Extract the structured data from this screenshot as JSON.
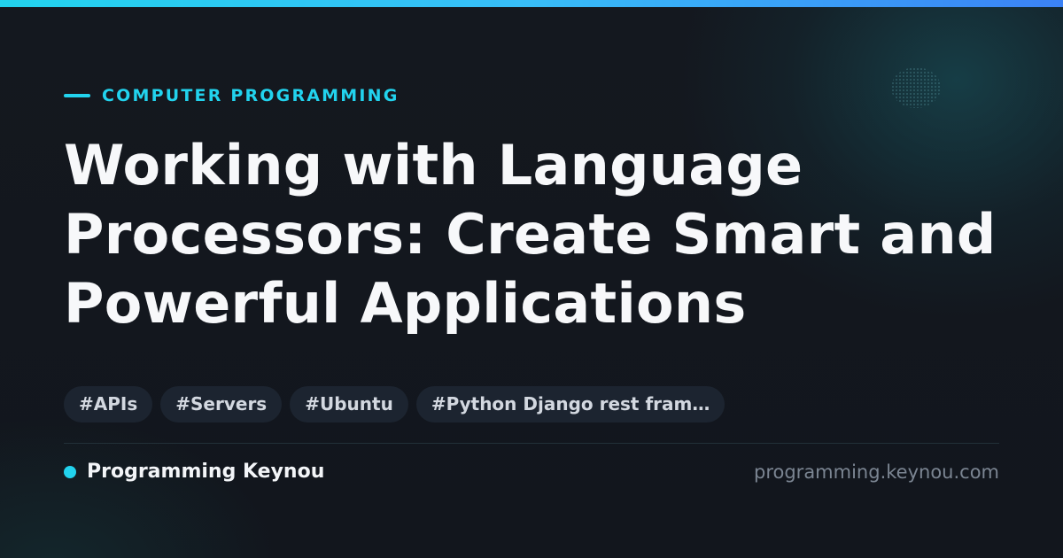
{
  "category": {
    "label": "COMPUTER PROGRAMMING"
  },
  "title": "Working with Language Processors: Create Smart and Powerful Applications",
  "tags": [
    "#APIs",
    "#Servers",
    "#Ubuntu",
    "#Python Django rest fram…"
  ],
  "footer": {
    "brand_name": "Programming Keynou",
    "site_url": "programming.keynou.com"
  },
  "colors": {
    "accent": "#22d3ee",
    "background": "#13171f",
    "title": "#f7f8fa",
    "tag_background": "#1c2430",
    "tag_text": "#d3d8e0",
    "muted_text": "#7b8592"
  }
}
